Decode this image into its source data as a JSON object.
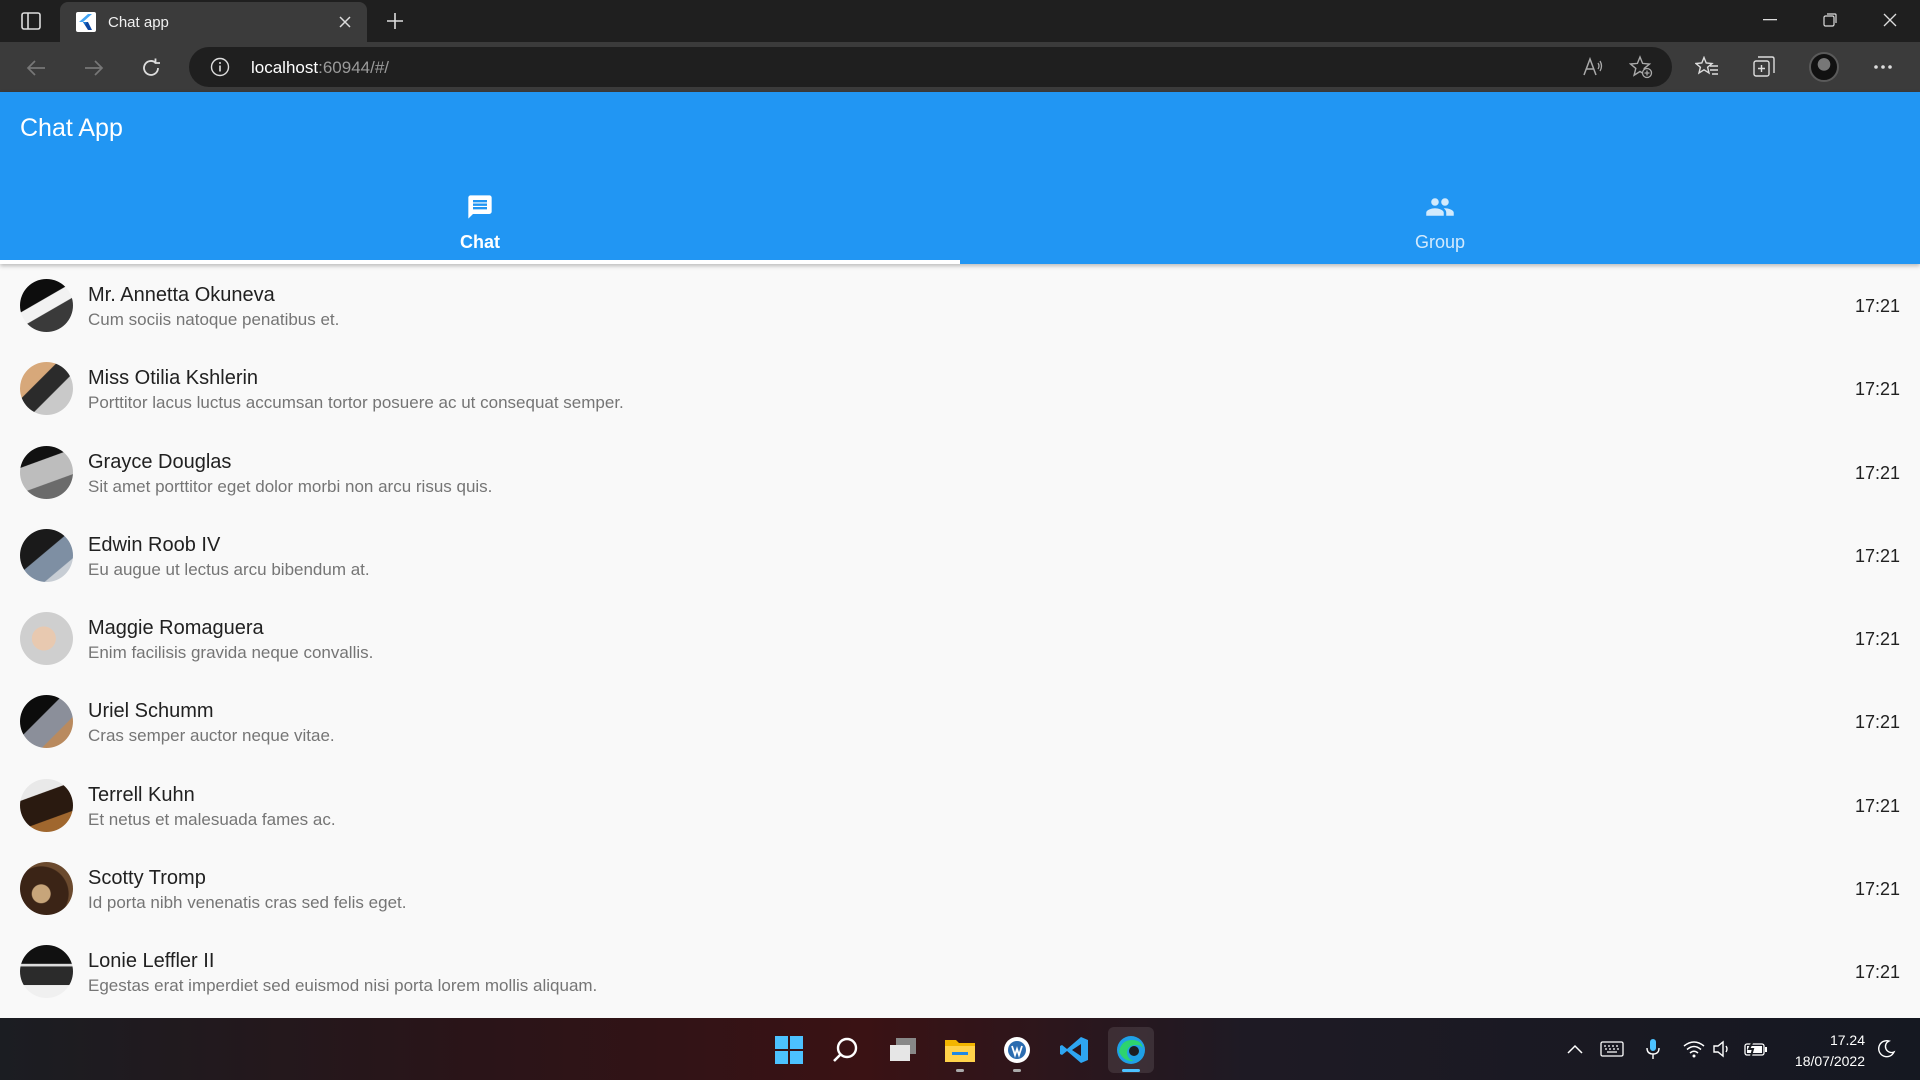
{
  "browser": {
    "tab_title": "Chat app",
    "url_host": "localhost",
    "url_path": ":60944/#/"
  },
  "app": {
    "title": "Chat App",
    "accent": "#2196f3",
    "tabs": [
      {
        "label": "Chat",
        "icon": "chat-bubble-icon",
        "active": true
      },
      {
        "label": "Group",
        "icon": "people-icon",
        "active": false
      }
    ]
  },
  "chats": [
    {
      "name": "Mr. Annetta Okuneva",
      "message": "Cum sociis natoque penatibus et.",
      "time": "17:21",
      "icon": "laptop-photo-avatar"
    },
    {
      "name": "Miss Otilia Kshlerin",
      "message": "Porttitor lacus luctus accumsan tortor posuere ac ut consequat semper.",
      "time": "17:21",
      "icon": "laptop-photo-avatar"
    },
    {
      "name": "Grayce Douglas",
      "message": "Sit amet porttitor eget dolor morbi non arcu risus quis.",
      "time": "17:21",
      "icon": "laptop-photo-avatar"
    },
    {
      "name": "Edwin Roob IV",
      "message": "Eu augue ut lectus arcu bibendum at.",
      "time": "17:21",
      "icon": "laptop-photo-avatar"
    },
    {
      "name": "Maggie Romaguera",
      "message": "Enim facilisis gravida neque convallis.",
      "time": "17:21",
      "icon": "hands-photo-avatar"
    },
    {
      "name": "Uriel Schumm",
      "message": "Cras semper auctor neque vitae.",
      "time": "17:21",
      "icon": "laptop-photo-avatar"
    },
    {
      "name": "Terrell Kuhn",
      "message": "Et netus et malesuada fames ac.",
      "time": "17:21",
      "icon": "laptop-photo-avatar"
    },
    {
      "name": "Scotty Tromp",
      "message": "Id porta nibh venenatis cras sed felis eget.",
      "time": "17:21",
      "icon": "desk-photo-avatar"
    },
    {
      "name": "Lonie Leffler II",
      "message": "Egestas erat imperdiet sed euismod nisi porta lorem mollis aliquam.",
      "time": "17:21",
      "icon": "keyboard-photo-avatar"
    }
  ],
  "taskbar": {
    "time": "17.24",
    "date": "18/07/2022"
  }
}
